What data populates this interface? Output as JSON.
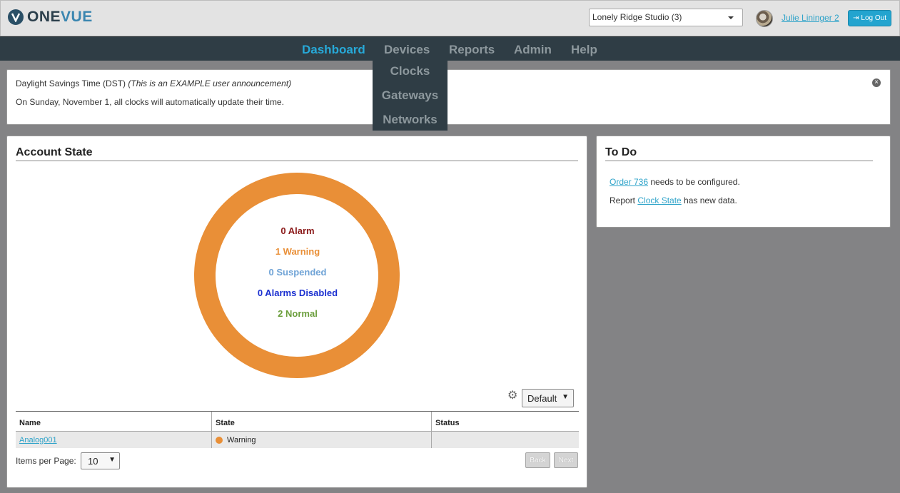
{
  "app": {
    "logo_one": "ONE",
    "logo_vue": "VUE",
    "logo_icon": "onevue-v-icon"
  },
  "header": {
    "site_selector": "Lonely Ridge Studio (3)",
    "user_name": "Julie Lininger 2",
    "logout_label": "Log Out"
  },
  "nav": {
    "items": [
      {
        "label": "Dashboard",
        "active": true
      },
      {
        "label": "Devices"
      },
      {
        "label": "Reports"
      },
      {
        "label": "Admin"
      },
      {
        "label": "Help"
      }
    ],
    "devices_menu": [
      "Clocks",
      "Gateways",
      "Networks"
    ]
  },
  "announcement": {
    "title": "Daylight Savings Time (DST)",
    "title_note": "(This is an EXAMPLE user announcement)",
    "body": "On Sunday, November 1, all clocks will automatically update their time."
  },
  "account_state": {
    "title": "Account State",
    "summary": [
      {
        "text": "0 Alarm",
        "color": "#8b1a1a"
      },
      {
        "text": "1 Warning",
        "color": "#e98f37"
      },
      {
        "text": "0 Suspended",
        "color": "#6fa3d6"
      },
      {
        "text": "0 Alarms Disabled",
        "color": "#1a2fd0"
      },
      {
        "text": "2 Normal",
        "color": "#6b9e3c"
      }
    ],
    "ring_color": "#e98f37",
    "view_selector": "Default",
    "columns": [
      "Name",
      "State",
      "Status"
    ],
    "rows": [
      {
        "name": "Analog001",
        "state": "Warning",
        "status": ""
      }
    ],
    "items_per_page_label": "Items per Page:",
    "items_per_page": "10",
    "back_label": "Back",
    "next_label": "Next"
  },
  "todo": {
    "title": "To Do",
    "item1_link": "Order 736",
    "item1_text": " needs to be configured.",
    "item2_prefix": "Report ",
    "item2_link": "Clock State",
    "item2_text": " has new data."
  }
}
